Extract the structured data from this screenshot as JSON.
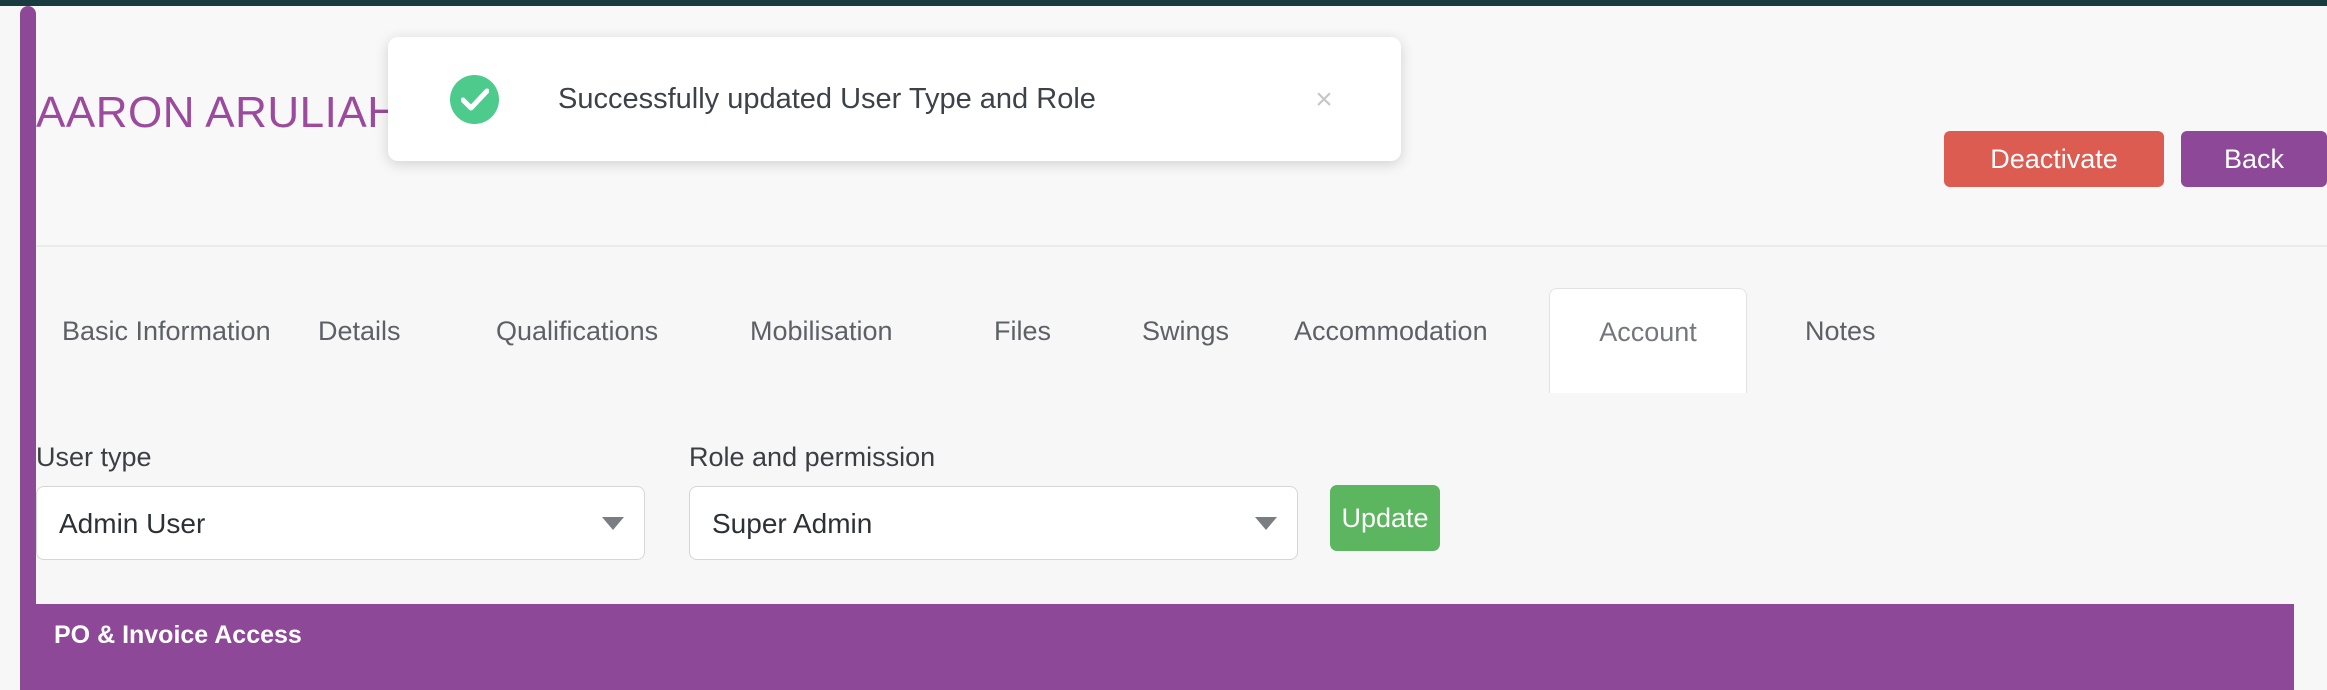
{
  "header": {
    "title": "AARON ARULIAH",
    "buttons": {
      "deactivate": "Deactivate",
      "back": "Back"
    }
  },
  "toast": {
    "message": "Successfully updated User Type and Role",
    "close_label": "×",
    "icon": "success-check-icon",
    "icon_color": "#4dcb8c"
  },
  "tabs": [
    {
      "label": "Basic Information",
      "active": false
    },
    {
      "label": "Details",
      "active": false
    },
    {
      "label": "Qualifications",
      "active": false
    },
    {
      "label": "Mobilisation",
      "active": false
    },
    {
      "label": "Files",
      "active": false
    },
    {
      "label": "Swings",
      "active": false
    },
    {
      "label": "Accommodation",
      "active": false
    },
    {
      "label": "Account",
      "active": true
    },
    {
      "label": "Notes",
      "active": false
    }
  ],
  "form": {
    "user_type": {
      "label": "User type",
      "value": "Admin User"
    },
    "role_permission": {
      "label": "Role and permission",
      "value": "Super Admin"
    },
    "update_button": "Update"
  },
  "section": {
    "po_invoice_access_title": "PO & Invoice Access"
  },
  "colors": {
    "brand_purple": "#8e4898",
    "title_purple": "#9b4a9e",
    "danger_red": "#dc5c52",
    "success_green": "#5cb55f",
    "toast_green": "#4dcb8c",
    "top_strip": "#183b3f",
    "page_background": "#f7f7f8"
  }
}
